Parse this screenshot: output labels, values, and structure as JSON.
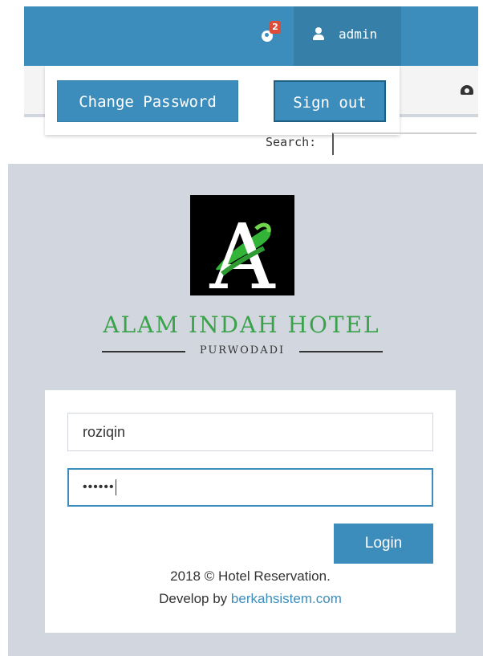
{
  "header": {
    "notification_count": "2",
    "user_name": "admin",
    "notification_icon": "globe-icon",
    "user_icon": "user-icon",
    "dashboard_icon": "dashboard-icon"
  },
  "user_dropdown": {
    "change_password_label": "Change Password",
    "sign_out_label": "Sign out"
  },
  "search": {
    "label": "Search:",
    "value": ""
  },
  "login": {
    "logo_letter": "A",
    "hotel_name": "ALAM INDAH HOTEL",
    "hotel_location": "PURWODADI",
    "username_value": "roziqin",
    "password_mask": "••••••",
    "login_button_label": "Login",
    "footer_text": "2018 © Hotel Reservation.",
    "develop_by_text": "Develop by",
    "developer_link": "berkahsistem.com"
  },
  "colors": {
    "primary": "#3c8dbc",
    "primary_dark": "#367fa9",
    "badge": "#dd4b39",
    "hotel_green": "#3aa24a",
    "login_background": "#d2d6de"
  }
}
